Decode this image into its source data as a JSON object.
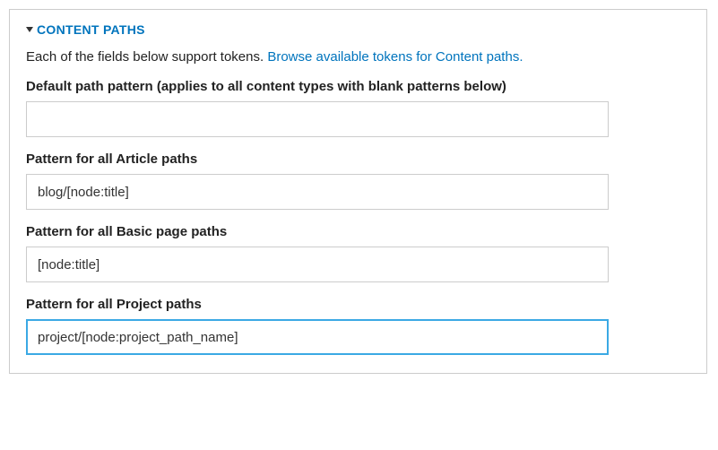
{
  "panel": {
    "title": "CONTENT PATHS",
    "intro_text": "Each of the fields below support tokens. ",
    "intro_link": "Browse available tokens for Content paths.",
    "fields": {
      "default": {
        "label": "Default path pattern (applies to all content types with blank patterns below)",
        "value": ""
      },
      "article": {
        "label": "Pattern for all Article paths",
        "value": "blog/[node:title]"
      },
      "basic_page": {
        "label": "Pattern for all Basic page paths",
        "value": "[node:title]"
      },
      "project": {
        "label": "Pattern for all Project paths",
        "value": "project/[node:project_path_name]"
      }
    }
  }
}
